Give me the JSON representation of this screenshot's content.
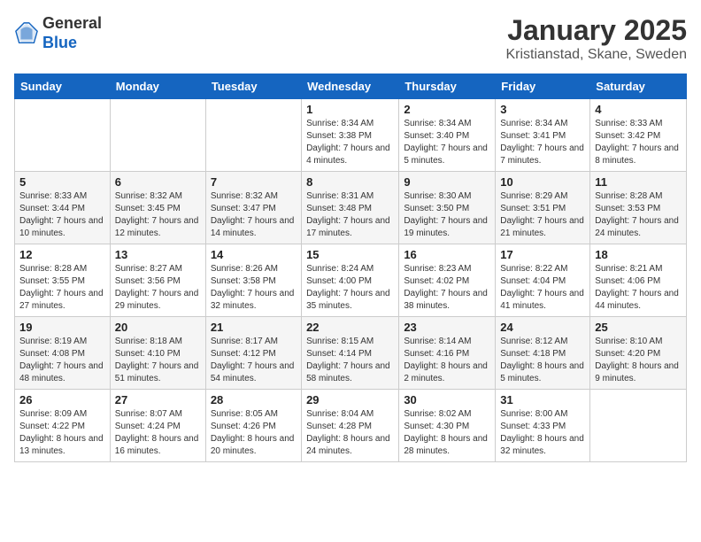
{
  "logo": {
    "general": "General",
    "blue": "Blue"
  },
  "header": {
    "title": "January 2025",
    "subtitle": "Kristianstad, Skane, Sweden"
  },
  "weekdays": [
    "Sunday",
    "Monday",
    "Tuesday",
    "Wednesday",
    "Thursday",
    "Friday",
    "Saturday"
  ],
  "weeks": [
    [
      {
        "day": "",
        "info": ""
      },
      {
        "day": "",
        "info": ""
      },
      {
        "day": "",
        "info": ""
      },
      {
        "day": "1",
        "info": "Sunrise: 8:34 AM\nSunset: 3:38 PM\nDaylight: 7 hours\nand 4 minutes."
      },
      {
        "day": "2",
        "info": "Sunrise: 8:34 AM\nSunset: 3:40 PM\nDaylight: 7 hours\nand 5 minutes."
      },
      {
        "day": "3",
        "info": "Sunrise: 8:34 AM\nSunset: 3:41 PM\nDaylight: 7 hours\nand 7 minutes."
      },
      {
        "day": "4",
        "info": "Sunrise: 8:33 AM\nSunset: 3:42 PM\nDaylight: 7 hours\nand 8 minutes."
      }
    ],
    [
      {
        "day": "5",
        "info": "Sunrise: 8:33 AM\nSunset: 3:44 PM\nDaylight: 7 hours\nand 10 minutes."
      },
      {
        "day": "6",
        "info": "Sunrise: 8:32 AM\nSunset: 3:45 PM\nDaylight: 7 hours\nand 12 minutes."
      },
      {
        "day": "7",
        "info": "Sunrise: 8:32 AM\nSunset: 3:47 PM\nDaylight: 7 hours\nand 14 minutes."
      },
      {
        "day": "8",
        "info": "Sunrise: 8:31 AM\nSunset: 3:48 PM\nDaylight: 7 hours\nand 17 minutes."
      },
      {
        "day": "9",
        "info": "Sunrise: 8:30 AM\nSunset: 3:50 PM\nDaylight: 7 hours\nand 19 minutes."
      },
      {
        "day": "10",
        "info": "Sunrise: 8:29 AM\nSunset: 3:51 PM\nDaylight: 7 hours\nand 21 minutes."
      },
      {
        "day": "11",
        "info": "Sunrise: 8:28 AM\nSunset: 3:53 PM\nDaylight: 7 hours\nand 24 minutes."
      }
    ],
    [
      {
        "day": "12",
        "info": "Sunrise: 8:28 AM\nSunset: 3:55 PM\nDaylight: 7 hours\nand 27 minutes."
      },
      {
        "day": "13",
        "info": "Sunrise: 8:27 AM\nSunset: 3:56 PM\nDaylight: 7 hours\nand 29 minutes."
      },
      {
        "day": "14",
        "info": "Sunrise: 8:26 AM\nSunset: 3:58 PM\nDaylight: 7 hours\nand 32 minutes."
      },
      {
        "day": "15",
        "info": "Sunrise: 8:24 AM\nSunset: 4:00 PM\nDaylight: 7 hours\nand 35 minutes."
      },
      {
        "day": "16",
        "info": "Sunrise: 8:23 AM\nSunset: 4:02 PM\nDaylight: 7 hours\nand 38 minutes."
      },
      {
        "day": "17",
        "info": "Sunrise: 8:22 AM\nSunset: 4:04 PM\nDaylight: 7 hours\nand 41 minutes."
      },
      {
        "day": "18",
        "info": "Sunrise: 8:21 AM\nSunset: 4:06 PM\nDaylight: 7 hours\nand 44 minutes."
      }
    ],
    [
      {
        "day": "19",
        "info": "Sunrise: 8:19 AM\nSunset: 4:08 PM\nDaylight: 7 hours\nand 48 minutes."
      },
      {
        "day": "20",
        "info": "Sunrise: 8:18 AM\nSunset: 4:10 PM\nDaylight: 7 hours\nand 51 minutes."
      },
      {
        "day": "21",
        "info": "Sunrise: 8:17 AM\nSunset: 4:12 PM\nDaylight: 7 hours\nand 54 minutes."
      },
      {
        "day": "22",
        "info": "Sunrise: 8:15 AM\nSunset: 4:14 PM\nDaylight: 7 hours\nand 58 minutes."
      },
      {
        "day": "23",
        "info": "Sunrise: 8:14 AM\nSunset: 4:16 PM\nDaylight: 8 hours\nand 2 minutes."
      },
      {
        "day": "24",
        "info": "Sunrise: 8:12 AM\nSunset: 4:18 PM\nDaylight: 8 hours\nand 5 minutes."
      },
      {
        "day": "25",
        "info": "Sunrise: 8:10 AM\nSunset: 4:20 PM\nDaylight: 8 hours\nand 9 minutes."
      }
    ],
    [
      {
        "day": "26",
        "info": "Sunrise: 8:09 AM\nSunset: 4:22 PM\nDaylight: 8 hours\nand 13 minutes."
      },
      {
        "day": "27",
        "info": "Sunrise: 8:07 AM\nSunset: 4:24 PM\nDaylight: 8 hours\nand 16 minutes."
      },
      {
        "day": "28",
        "info": "Sunrise: 8:05 AM\nSunset: 4:26 PM\nDaylight: 8 hours\nand 20 minutes."
      },
      {
        "day": "29",
        "info": "Sunrise: 8:04 AM\nSunset: 4:28 PM\nDaylight: 8 hours\nand 24 minutes."
      },
      {
        "day": "30",
        "info": "Sunrise: 8:02 AM\nSunset: 4:30 PM\nDaylight: 8 hours\nand 28 minutes."
      },
      {
        "day": "31",
        "info": "Sunrise: 8:00 AM\nSunset: 4:33 PM\nDaylight: 8 hours\nand 32 minutes."
      },
      {
        "day": "",
        "info": ""
      }
    ]
  ]
}
